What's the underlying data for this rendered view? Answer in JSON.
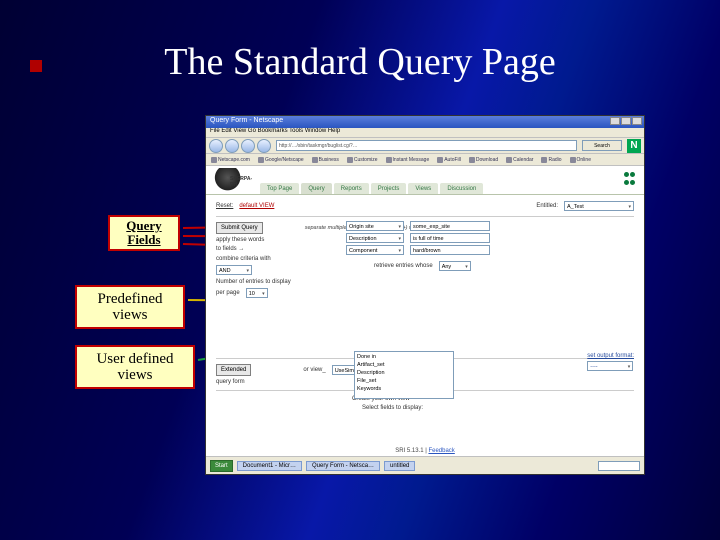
{
  "slide": {
    "title": "The Standard Query Page",
    "annotations": {
      "query_fields": "Query Fields",
      "predefined_views": "Predefined views",
      "user_defined_views": "User defined views"
    }
  },
  "browser": {
    "window_title": "Query Form - Netscape",
    "menu": "File  Edit  View  Go  Bookmarks  Tools  Window  Help",
    "url": "http://…/sbin/taskmgr/buglist.cgi?…",
    "search_btn": "Search",
    "n_logo": "N",
    "bookmarks": [
      "Netscape.com",
      "Google/Netscape",
      "Business",
      "Customize",
      "Instant Message",
      "AutoFill",
      "Download",
      "Calendar",
      "Radio",
      "Online"
    ]
  },
  "tabs": {
    "items": [
      "Top Page",
      "Query",
      "Reports",
      "Projects",
      "Views",
      "Discussion"
    ],
    "active": 1
  },
  "query": {
    "reset_label": "Reset:",
    "default": "default VIEW",
    "entitled_lbl": "Entitled:",
    "entitled_val": "A_Test",
    "submit_btn": "Submit Query",
    "hint": "separate multiple values by a '/' and  (ctrl+) word text",
    "apply_lbl": "apply these words",
    "to_fields_lbl": "to fields →",
    "combine_lbl": "combine criteria with",
    "combine_val": "AND",
    "numlines_lbl": "Number of entries to display",
    "perpage_lbl": "per page",
    "perpage_val": "10",
    "criteria": [
      {
        "name": "Origin site",
        "value": "some_exp_site"
      },
      {
        "name": "Description",
        "value": "is full of time"
      },
      {
        "name": "Component",
        "value": "hard/brown"
      }
    ],
    "within_lbl": "retrieve entries whose",
    "within_val": "Any",
    "view_sep": "",
    "defaultview_lbl": "or view_",
    "extended_btn": "Extended",
    "query_form_lbl": "query form",
    "usesimple_val": "UseSimpleView",
    "create_lbl": "Create your own view",
    "select_lbl": "Select fields to display:",
    "fields_list": [
      "Done in",
      "Artifact_set",
      "Description",
      "File_set",
      "Keywords"
    ],
    "output_lbl": "set output format:",
    "output_val": "----"
  },
  "footer": {
    "text": "SRI 5.13.1",
    "link": "Feedback"
  },
  "taskbar": {
    "start": "Start",
    "items": [
      "Document1 - Micr…",
      "Query Form - Netsca…",
      "untitled"
    ],
    "clock": ""
  },
  "icons": {
    "gear": "gear-icon",
    "paw": "paw-icon"
  }
}
